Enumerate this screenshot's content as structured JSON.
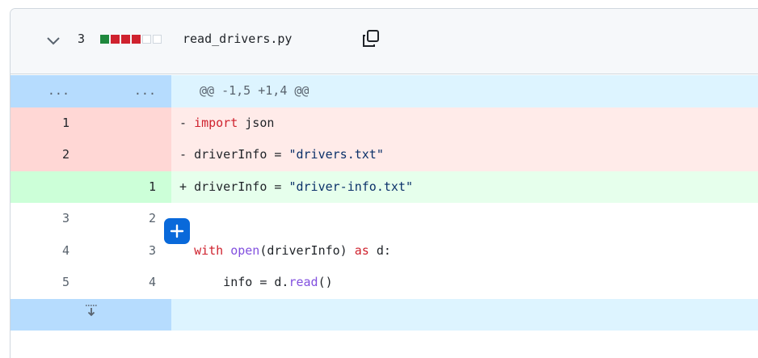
{
  "file": {
    "change_count": "3",
    "name": "read_drivers.py",
    "diffstat": [
      "add",
      "del",
      "del",
      "del",
      "neutral",
      "neutral"
    ]
  },
  "hunk": {
    "old_marker": "...",
    "new_marker": "...",
    "header": "@@ -1,5 +1,4 @@"
  },
  "lines": [
    {
      "type": "del",
      "old": "1",
      "new": "",
      "sign": "-"
    },
    {
      "type": "del",
      "old": "2",
      "new": "",
      "sign": "-"
    },
    {
      "type": "add",
      "old": "",
      "new": "1",
      "sign": "+"
    },
    {
      "type": "ctx",
      "old": "3",
      "new": "2",
      "sign": ""
    },
    {
      "type": "ctx",
      "old": "4",
      "new": "3",
      "sign": ""
    },
    {
      "type": "ctx",
      "old": "5",
      "new": "4",
      "sign": ""
    }
  ],
  "code": {
    "l1_kw": "import",
    "l1_rest": " json",
    "l2_a": "driverInfo = ",
    "l2_str": "\"drivers.txt\"",
    "l3_a": "driverInfo = ",
    "l3_str": "\"driver-info.txt\"",
    "l5_kw": "with",
    "l5_sp": " ",
    "l5_fn": "open",
    "l5_b": "(driverInfo) ",
    "l5_kw2": "as",
    "l5_c": " d:",
    "l6_a": "    info = d.",
    "l6_fn": "read",
    "l6_b": "()"
  },
  "colors": {
    "add_bg": "#e6ffec",
    "del_bg": "#ffebe9",
    "hunk_bg": "#ddf4ff",
    "accent": "#0969da"
  },
  "icons": {
    "chevron": "chevron-down-icon",
    "copy": "copy-icon",
    "plus": "plus-icon",
    "expand": "unfold-down-icon"
  }
}
